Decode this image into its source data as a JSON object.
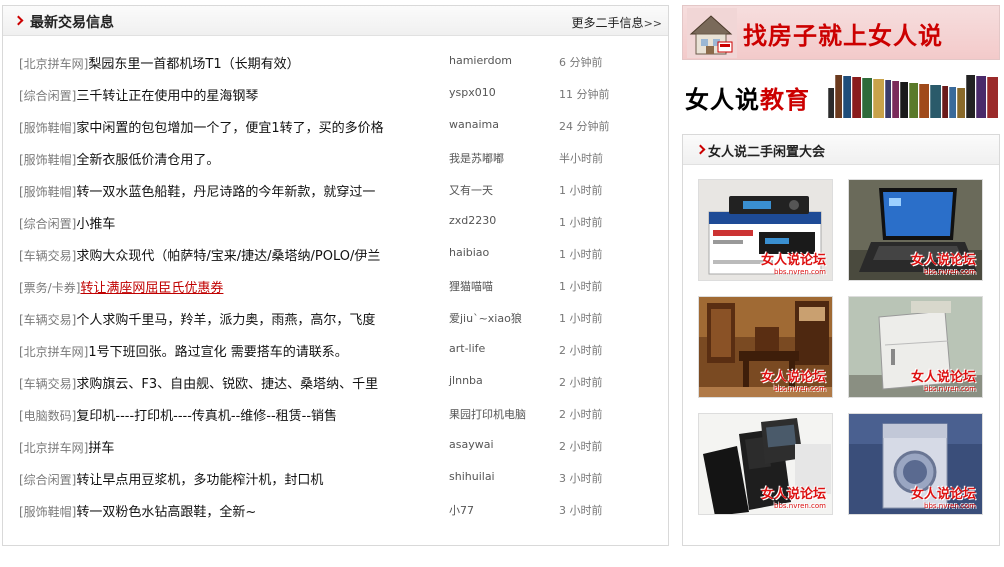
{
  "latest": {
    "title": "最新交易信息",
    "more_label": "更多二手信息",
    "more_suffix": ">>",
    "items": [
      {
        "category": "[北京拼车网]",
        "title": "梨园东里一首都机场T1（长期有效）",
        "user": "hamierdom",
        "time": "6 分钟前"
      },
      {
        "category": "[综合闲置]",
        "title": "三千转让正在使用中的星海钢琴",
        "user": "yspx010",
        "time": "11 分钟前"
      },
      {
        "category": "[服饰鞋帽]",
        "title": "家中闲置的包包增加一个了，便宜1转了，买的多价格",
        "user": "wanaima",
        "time": "24 分钟前"
      },
      {
        "category": "[服饰鞋帽]",
        "title": "全新衣服低价清仓用了。",
        "user": "我是苏嘟嘟",
        "time": "半小时前"
      },
      {
        "category": "[服饰鞋帽]",
        "title": "转一双水蓝色船鞋，丹尼诗路的今年新款，就穿过一",
        "user": "又有一天",
        "time": "1 小时前"
      },
      {
        "category": "[综合闲置]",
        "title": "小推车",
        "user": "zxd2230",
        "time": "1 小时前"
      },
      {
        "category": "[车辆交易]",
        "title": "求购大众现代（帕萨特/宝来/捷达/桑塔纳/POLO/伊兰",
        "user": "haibiao",
        "time": "1 小时前"
      },
      {
        "category": "[票务/卡券]",
        "title": "转让满座网屈臣氏优惠券",
        "user": "狸猫喵喵",
        "time": "1 小时前",
        "highlight": true
      },
      {
        "category": "[车辆交易]",
        "title": "个人求购千里马，羚羊，派力奥，雨燕，高尔，飞度",
        "user": "爱jiu`~xiao狼",
        "time": "1 小时前"
      },
      {
        "category": "[北京拼车网]",
        "title": "1号下班回张。路过宣化 需要搭车的请联系。",
        "user": "art-life",
        "time": "2 小时前"
      },
      {
        "category": "[车辆交易]",
        "title": "求购旗云、F3、自由舰、锐欧、捷达、桑塔纳、千里",
        "user": "jlnnba",
        "time": "2 小时前"
      },
      {
        "category": "[电脑数码]",
        "title": "复印机----打印机----传真机--维修--租赁--销售",
        "user": "果园打印机电脑",
        "time": "2 小时前"
      },
      {
        "category": "[北京拼车网]",
        "title": "拼车",
        "user": "asaywai",
        "time": "2 小时前"
      },
      {
        "category": "[综合闲置]",
        "title": "转让早点用豆浆机，多功能榨汁机，封口机",
        "user": "shihuilai",
        "time": "3 小时前"
      },
      {
        "category": "[服饰鞋帽]",
        "title": "转一双粉色水钻高跟鞋，全新~",
        "user": "小77",
        "time": "3 小时前"
      }
    ]
  },
  "ads": {
    "house_slogan": "找房子就上女人说",
    "edu_brand_a": "女人说",
    "edu_brand_b": "教育"
  },
  "secondhand": {
    "title": "女人说二手闲置大会",
    "watermark": "女人说论坛",
    "watermark_url": "bbs.nvren.com",
    "thumbs": [
      {
        "icon": "car-stereo-photo"
      },
      {
        "icon": "laptop-photo"
      },
      {
        "icon": "wooden-furniture-photo"
      },
      {
        "icon": "mini-fridge-photo"
      },
      {
        "icon": "phones-photo"
      },
      {
        "icon": "washing-machine-photo"
      }
    ]
  },
  "colors": {
    "accent": "#cc0000",
    "border": "#d9d9d9",
    "category": "#7a7a7a"
  }
}
